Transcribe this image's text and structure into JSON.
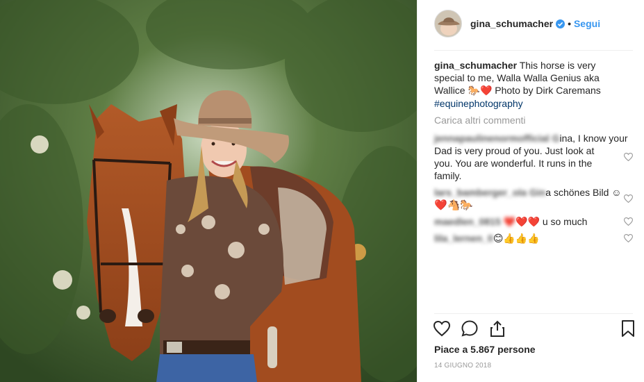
{
  "post": {
    "username": "gina_schumacher",
    "separator": "•",
    "follow_label": "Segui"
  },
  "caption": {
    "user": "gina_schumacher",
    "line1": "This horse is very",
    "line2": "special to me, Walla Walla Genius aka",
    "line3": "Wallice",
    "line3_emoji_horse": "🐎",
    "line3_emoji_heart": "❤️",
    "line3_tail": "Photo by Dirk Caremans",
    "hashtag": "#equinephotography"
  },
  "load_more_label": "Carica altri commenti",
  "comments": [
    {
      "user_blurred": "jennapaulinenormofficial G",
      "lines": [
        "ina, I know your",
        "Dad is very proud of you. Just look at",
        "you. You are wonderful. It runs in the",
        "family."
      ]
    },
    {
      "user_blurred": "lars_bamberger_ola Gin",
      "text": "a schönes Bild ☺",
      "emoji_line": "❤️🐴🐎"
    },
    {
      "user_blurred": "maedlen_0815 ❤️",
      "emoji": "❤️❤️",
      "text": "u so much"
    },
    {
      "user_blurred": "lila_lernen_0",
      "text_prefix": "li",
      "emoji": "😊👍👍👍"
    }
  ],
  "actions": {
    "like_icon": "heart-outline",
    "comment_icon": "speech-bubble",
    "share_icon": "share-arrow",
    "save_icon": "bookmark"
  },
  "likes_label": "Piace a 5.867 persone",
  "date_label": "14 GIUGNO 2018",
  "colors": {
    "link_blue": "#3897f0",
    "hashtag": "#003569",
    "muted": "#999999",
    "border": "#efefef"
  }
}
